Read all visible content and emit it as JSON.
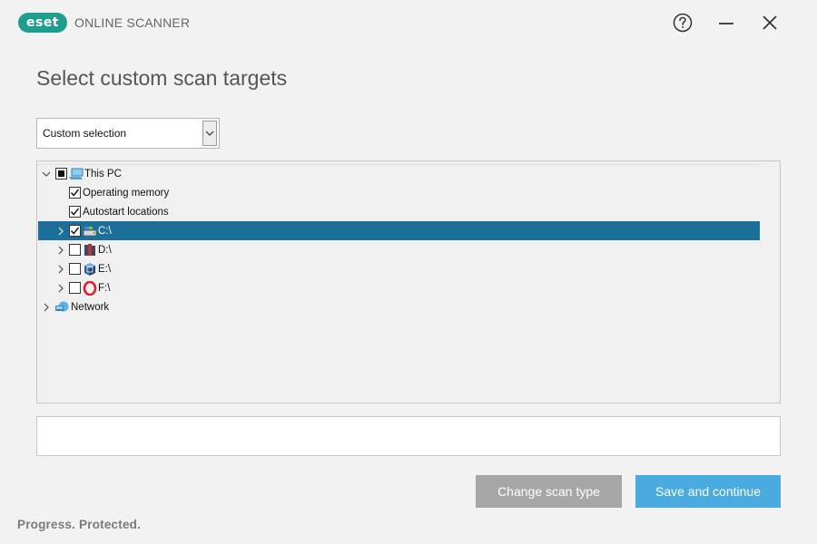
{
  "app": {
    "logo_text": "eset",
    "product_name": "ONLINE SCANNER",
    "brand_color": "#1f9e8f"
  },
  "window_controls": {
    "help_icon": "help-circle-icon",
    "minimize_icon": "minimize-icon",
    "close_icon": "close-icon"
  },
  "page": {
    "title": "Select custom scan targets"
  },
  "scan_profile": {
    "selected": "Custom selection"
  },
  "tree": {
    "selected_row_color": "#1b6f98",
    "nodes": [
      {
        "label": "This PC",
        "icon": "computer-icon",
        "checked": "partial",
        "expander": "expanded"
      },
      {
        "label": "Operating memory",
        "checked": true
      },
      {
        "label": "Autostart locations",
        "checked": true
      },
      {
        "label": "C:\\",
        "icon": "hard-drive-icon",
        "checked": true,
        "expander": "collapsed",
        "selected": true
      },
      {
        "label": "D:\\",
        "icon": "book-drive-icon",
        "checked": false,
        "expander": "collapsed"
      },
      {
        "label": "E:\\",
        "icon": "cube-drive-icon",
        "checked": false,
        "expander": "collapsed"
      },
      {
        "label": "F:\\",
        "icon": "opera-drive-icon",
        "checked": false,
        "expander": "collapsed"
      },
      {
        "label": "Network",
        "icon": "network-icon",
        "expander": "collapsed"
      }
    ]
  },
  "buttons": {
    "change_scan_type": "Change scan type",
    "save_and_continue": "Save and continue",
    "secondary_color": "#a6a6a6",
    "primary_color": "#49abdf"
  },
  "footer": {
    "tagline": "Progress. Protected."
  }
}
